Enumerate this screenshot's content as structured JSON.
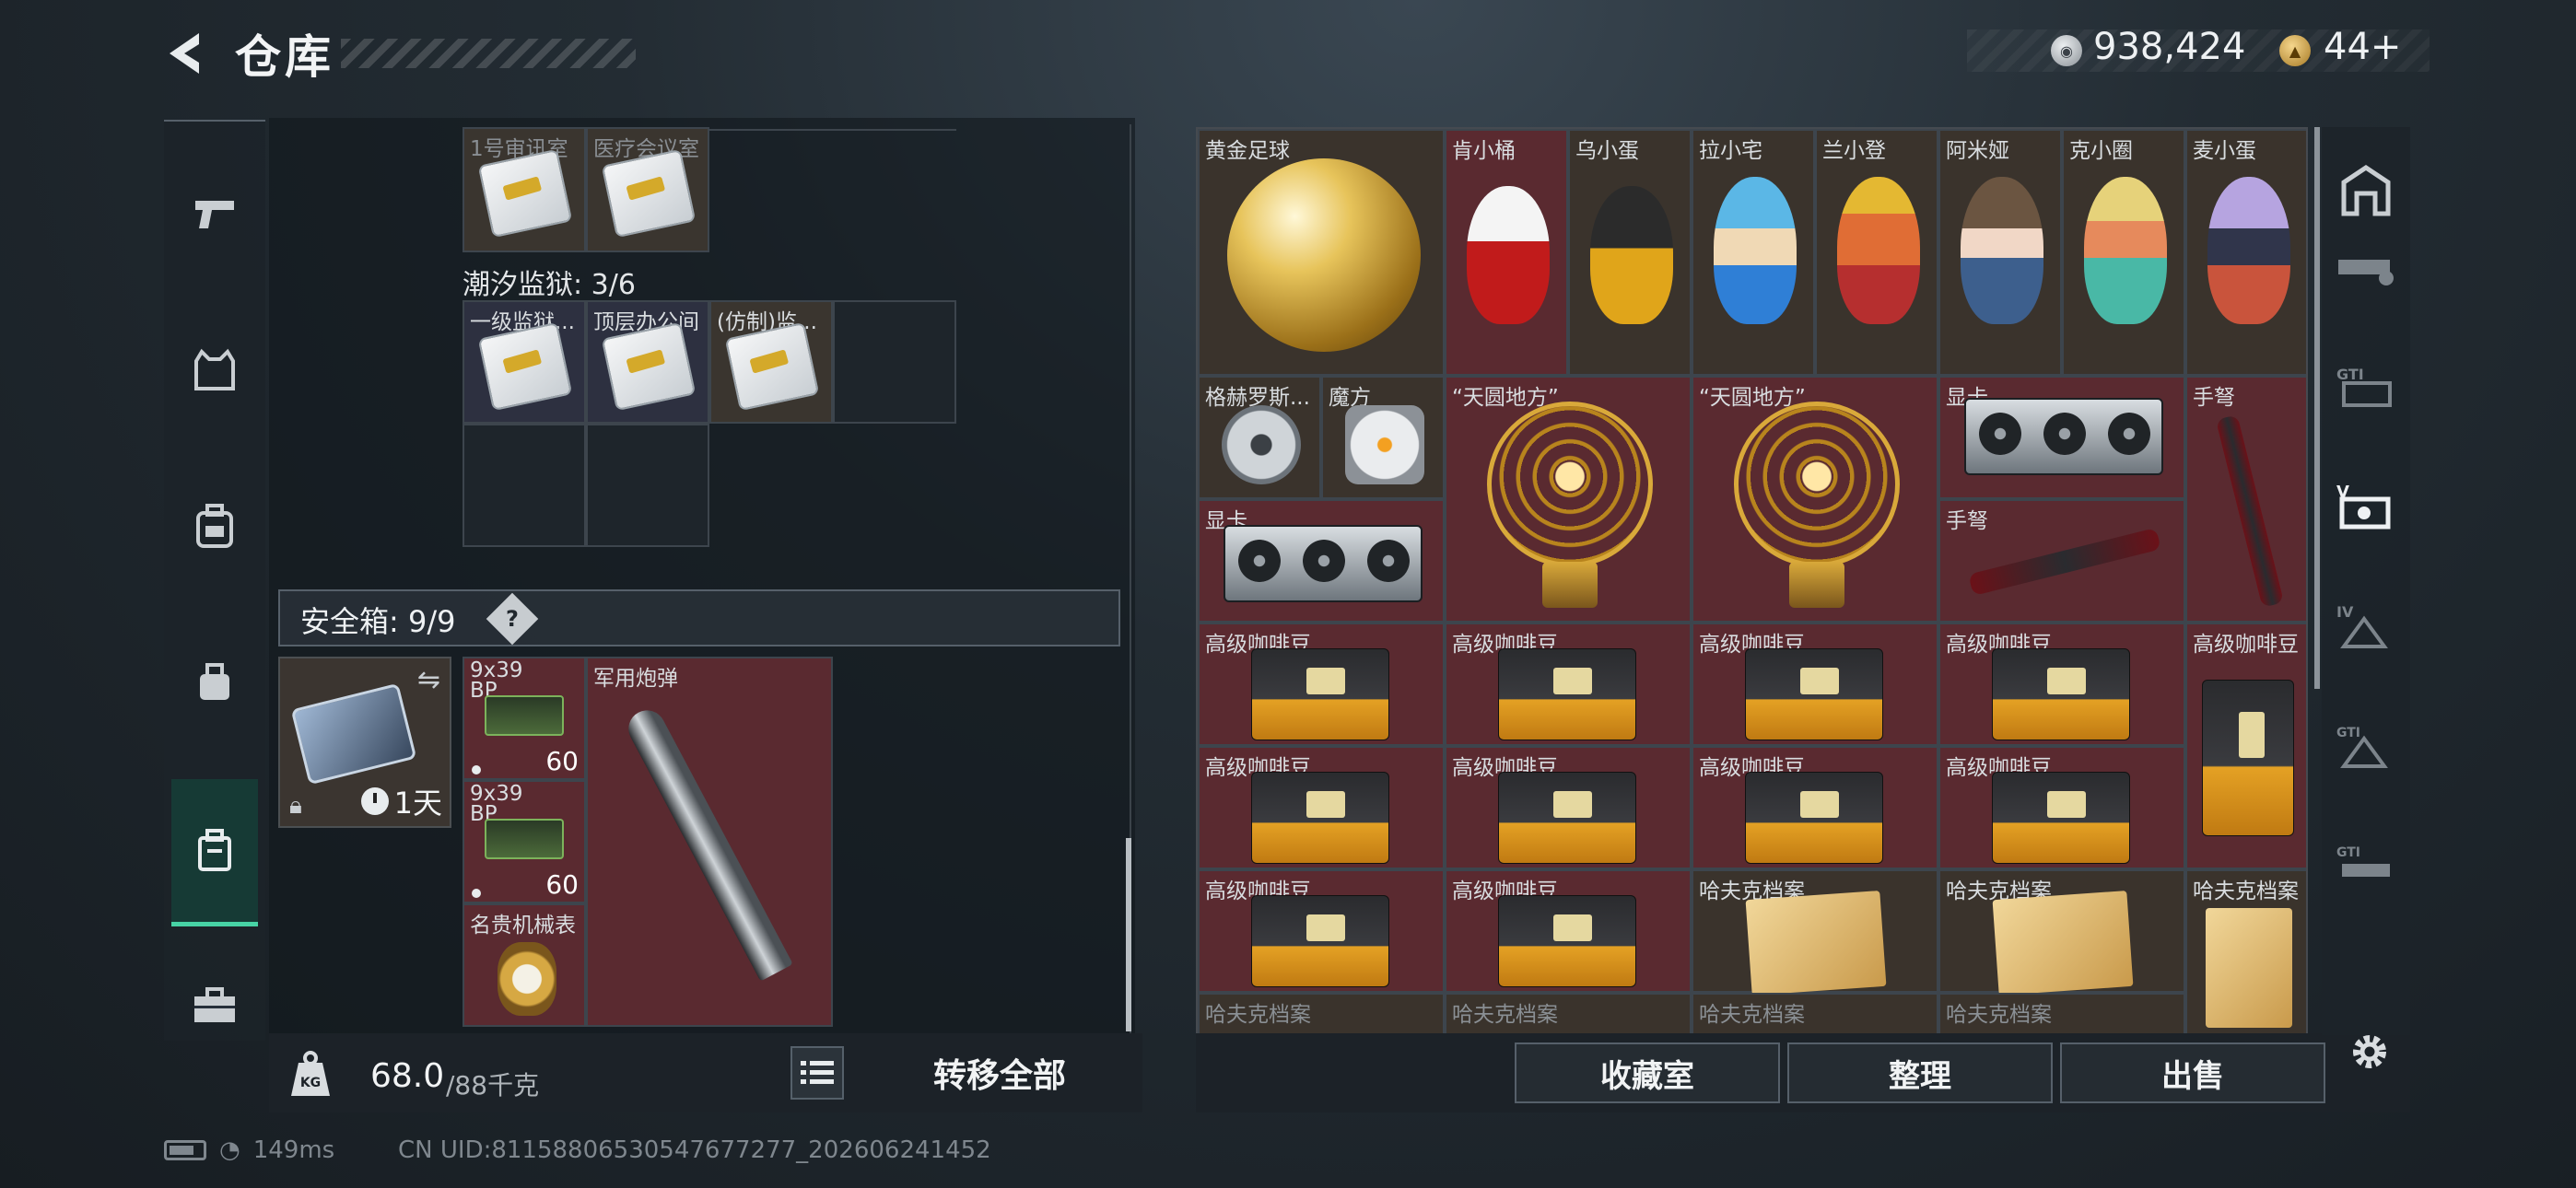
{
  "header": {
    "back_icon": "chevron-left-icon",
    "title": "仓库",
    "currency_silver_icon": "silver-coin-icon",
    "currency_gold_icon": "gold-coin-icon",
    "money": "938,424",
    "coins": "44+"
  },
  "left_nav": {
    "items": [
      {
        "icon": "pistol-icon"
      },
      {
        "icon": "armor-vest-icon"
      },
      {
        "icon": "backpack-icon"
      },
      {
        "icon": "pouch-icon"
      },
      {
        "icon": "safe-box-icon",
        "active": true
      },
      {
        "icon": "toolbox-icon"
      }
    ]
  },
  "storage": {
    "top_cards": [
      {
        "label": "1号审讯室"
      },
      {
        "label": "医疗会议室"
      }
    ],
    "prison_label": "潮汐监狱: 3/6",
    "prison_cards": [
      {
        "label": "一级监狱..."
      },
      {
        "label": "顶层办公间"
      },
      {
        "label": "(仿制)监..."
      }
    ]
  },
  "safebox": {
    "label": "安全箱: 9/9",
    "help": "?",
    "timer": "1天",
    "items": [
      {
        "label": "9x39 BP",
        "count": "60"
      },
      {
        "label": "9x39 BP",
        "count": "60"
      },
      {
        "label": "军用炮弹"
      },
      {
        "label": "名贵机械表"
      }
    ]
  },
  "footer_left": {
    "weight_value": "68.0",
    "weight_max": "/88千克",
    "transfer_all": "转移全部"
  },
  "collection": {
    "row1": [
      "黄金足球",
      "肯小桶",
      "乌小蛋",
      "拉小宅",
      "兰小登",
      "阿米娅",
      "克小圈",
      "麦小蛋"
    ],
    "row2": [
      "格赫罗斯...",
      "魔方",
      "“天圆地方”",
      "“天圆地方”",
      "显卡",
      "手弩"
    ],
    "row3": [
      "显卡",
      "手弩"
    ],
    "coffee": "高级咖啡豆",
    "file": "哈夫克档案"
  },
  "footer_right": {
    "buttons": [
      "收藏室",
      "整理",
      "出售"
    ]
  },
  "right_nav": {
    "items": [
      {
        "icon": "home-base-icon"
      },
      {
        "icon": "rifle-case-icon"
      },
      {
        "icon": "gti-case-icon"
      },
      {
        "icon": "gti-case-v-icon",
        "active": true
      },
      {
        "icon": "gti-case-iv-icon"
      },
      {
        "icon": "gti-case-triangle-icon"
      },
      {
        "icon": "gti-case-rifle-icon"
      }
    ],
    "settings_icon": "gear-icon"
  },
  "status": {
    "ping": "149ms",
    "uid": "CN UID:8115880653054767727​7_202606241452"
  }
}
